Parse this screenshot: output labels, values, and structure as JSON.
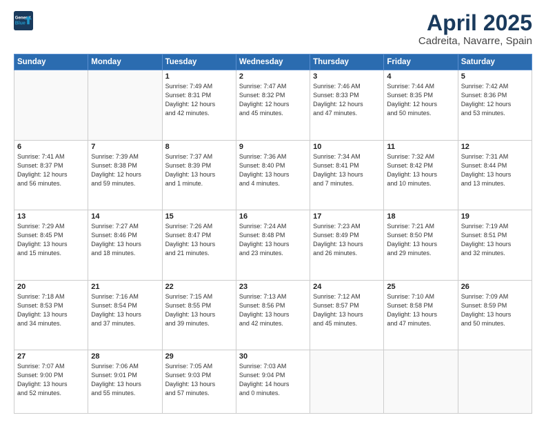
{
  "header": {
    "logo_line1": "General",
    "logo_line2": "Blue",
    "title": "April 2025",
    "subtitle": "Cadreita, Navarre, Spain"
  },
  "weekdays": [
    "Sunday",
    "Monday",
    "Tuesday",
    "Wednesday",
    "Thursday",
    "Friday",
    "Saturday"
  ],
  "weeks": [
    [
      {
        "day": "",
        "info": ""
      },
      {
        "day": "",
        "info": ""
      },
      {
        "day": "1",
        "info": "Sunrise: 7:49 AM\nSunset: 8:31 PM\nDaylight: 12 hours\nand 42 minutes."
      },
      {
        "day": "2",
        "info": "Sunrise: 7:47 AM\nSunset: 8:32 PM\nDaylight: 12 hours\nand 45 minutes."
      },
      {
        "day": "3",
        "info": "Sunrise: 7:46 AM\nSunset: 8:33 PM\nDaylight: 12 hours\nand 47 minutes."
      },
      {
        "day": "4",
        "info": "Sunrise: 7:44 AM\nSunset: 8:35 PM\nDaylight: 12 hours\nand 50 minutes."
      },
      {
        "day": "5",
        "info": "Sunrise: 7:42 AM\nSunset: 8:36 PM\nDaylight: 12 hours\nand 53 minutes."
      }
    ],
    [
      {
        "day": "6",
        "info": "Sunrise: 7:41 AM\nSunset: 8:37 PM\nDaylight: 12 hours\nand 56 minutes."
      },
      {
        "day": "7",
        "info": "Sunrise: 7:39 AM\nSunset: 8:38 PM\nDaylight: 12 hours\nand 59 minutes."
      },
      {
        "day": "8",
        "info": "Sunrise: 7:37 AM\nSunset: 8:39 PM\nDaylight: 13 hours\nand 1 minute."
      },
      {
        "day": "9",
        "info": "Sunrise: 7:36 AM\nSunset: 8:40 PM\nDaylight: 13 hours\nand 4 minutes."
      },
      {
        "day": "10",
        "info": "Sunrise: 7:34 AM\nSunset: 8:41 PM\nDaylight: 13 hours\nand 7 minutes."
      },
      {
        "day": "11",
        "info": "Sunrise: 7:32 AM\nSunset: 8:42 PM\nDaylight: 13 hours\nand 10 minutes."
      },
      {
        "day": "12",
        "info": "Sunrise: 7:31 AM\nSunset: 8:44 PM\nDaylight: 13 hours\nand 13 minutes."
      }
    ],
    [
      {
        "day": "13",
        "info": "Sunrise: 7:29 AM\nSunset: 8:45 PM\nDaylight: 13 hours\nand 15 minutes."
      },
      {
        "day": "14",
        "info": "Sunrise: 7:27 AM\nSunset: 8:46 PM\nDaylight: 13 hours\nand 18 minutes."
      },
      {
        "day": "15",
        "info": "Sunrise: 7:26 AM\nSunset: 8:47 PM\nDaylight: 13 hours\nand 21 minutes."
      },
      {
        "day": "16",
        "info": "Sunrise: 7:24 AM\nSunset: 8:48 PM\nDaylight: 13 hours\nand 23 minutes."
      },
      {
        "day": "17",
        "info": "Sunrise: 7:23 AM\nSunset: 8:49 PM\nDaylight: 13 hours\nand 26 minutes."
      },
      {
        "day": "18",
        "info": "Sunrise: 7:21 AM\nSunset: 8:50 PM\nDaylight: 13 hours\nand 29 minutes."
      },
      {
        "day": "19",
        "info": "Sunrise: 7:19 AM\nSunset: 8:51 PM\nDaylight: 13 hours\nand 32 minutes."
      }
    ],
    [
      {
        "day": "20",
        "info": "Sunrise: 7:18 AM\nSunset: 8:53 PM\nDaylight: 13 hours\nand 34 minutes."
      },
      {
        "day": "21",
        "info": "Sunrise: 7:16 AM\nSunset: 8:54 PM\nDaylight: 13 hours\nand 37 minutes."
      },
      {
        "day": "22",
        "info": "Sunrise: 7:15 AM\nSunset: 8:55 PM\nDaylight: 13 hours\nand 39 minutes."
      },
      {
        "day": "23",
        "info": "Sunrise: 7:13 AM\nSunset: 8:56 PM\nDaylight: 13 hours\nand 42 minutes."
      },
      {
        "day": "24",
        "info": "Sunrise: 7:12 AM\nSunset: 8:57 PM\nDaylight: 13 hours\nand 45 minutes."
      },
      {
        "day": "25",
        "info": "Sunrise: 7:10 AM\nSunset: 8:58 PM\nDaylight: 13 hours\nand 47 minutes."
      },
      {
        "day": "26",
        "info": "Sunrise: 7:09 AM\nSunset: 8:59 PM\nDaylight: 13 hours\nand 50 minutes."
      }
    ],
    [
      {
        "day": "27",
        "info": "Sunrise: 7:07 AM\nSunset: 9:00 PM\nDaylight: 13 hours\nand 52 minutes."
      },
      {
        "day": "28",
        "info": "Sunrise: 7:06 AM\nSunset: 9:01 PM\nDaylight: 13 hours\nand 55 minutes."
      },
      {
        "day": "29",
        "info": "Sunrise: 7:05 AM\nSunset: 9:03 PM\nDaylight: 13 hours\nand 57 minutes."
      },
      {
        "day": "30",
        "info": "Sunrise: 7:03 AM\nSunset: 9:04 PM\nDaylight: 14 hours\nand 0 minutes."
      },
      {
        "day": "",
        "info": ""
      },
      {
        "day": "",
        "info": ""
      },
      {
        "day": "",
        "info": ""
      }
    ]
  ]
}
